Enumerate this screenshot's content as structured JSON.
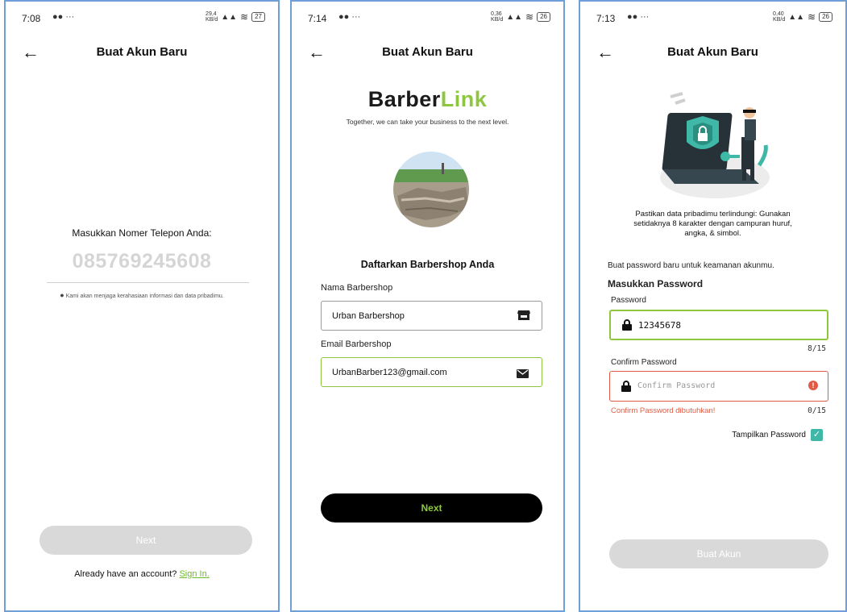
{
  "colors": {
    "accent": "#8ec63f",
    "link": "#6dbb2a",
    "error": "#e05a44",
    "frame": "#6f9fd8",
    "disabled": "#d9d9d9",
    "checkbox": "#3fb8a7"
  },
  "screen1": {
    "status": {
      "time": "7:08",
      "net": "29,4\nKB/d",
      "battery": "27"
    },
    "title": "Buat Akun Baru",
    "prompt": "Masukkan Nomer Telepon Anda:",
    "phone_value": "085769245608",
    "privacy_note": "Kami akan menjaga kerahasiaan informasi dan data pribadimu.",
    "next_label": "Next",
    "signin_text": "Already have an account?",
    "signin_link": "Sign In."
  },
  "screen2": {
    "status": {
      "time": "7:14",
      "net": "0,36\nKB/d",
      "battery": "26"
    },
    "title": "Buat Akun Baru",
    "brand_part1": "Barber",
    "brand_part2": "Link",
    "tagline": "Together, we can take your business to the next level.",
    "section_title": "Daftarkan Barbershop Anda",
    "name_label": "Nama Barbershop",
    "name_value": "Urban Barbershop",
    "email_label": "Email Barbershop",
    "email_value": "UrbanBarber123@gmail.com",
    "next_label": "Next"
  },
  "screen3": {
    "status": {
      "time": "7:13",
      "net": "0,40\nKB/d",
      "battery": "26"
    },
    "title": "Buat Akun Baru",
    "tip_line1": "Pastikan data pribadimu terlindungi: Gunakan",
    "tip_line2": "setidaknya 8 karakter dengan campuran huruf,",
    "tip_line3": "angka, & simbol.",
    "instruction": "Buat password baru untuk keamanan akunmu.",
    "heading": "Masukkan Password",
    "password_label": "Password",
    "password_value": "12345678",
    "password_counter": "8/15",
    "confirm_label": "Confirm Password",
    "confirm_placeholder": "Confirm Password",
    "confirm_error": "Confirm Password dibutuhkan!",
    "confirm_counter": "0/15",
    "show_password_label": "Tampilkan Password",
    "show_password_checked": true,
    "submit_label": "Buat Akun"
  }
}
